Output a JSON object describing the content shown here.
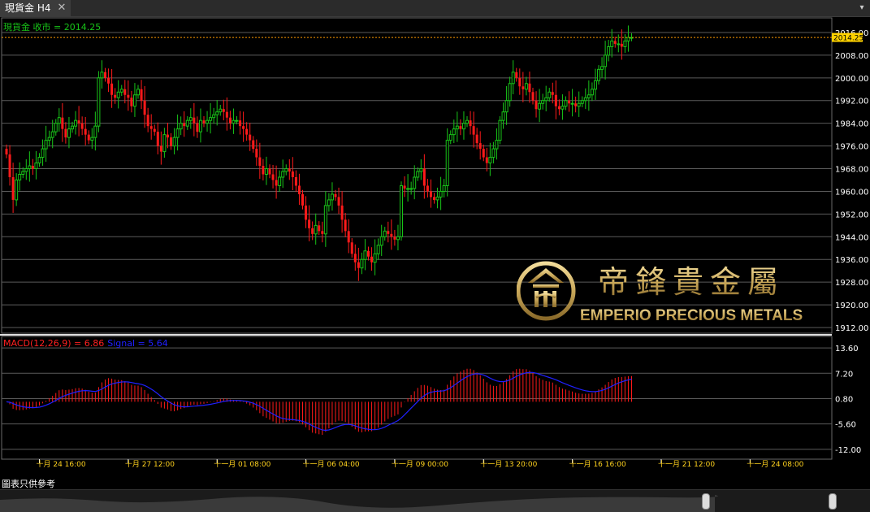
{
  "window": {
    "tab_title": "現貨金 H4",
    "close_glyph": "✕",
    "menu_glyph": "▾"
  },
  "main_legend": "現貨金 收市 = 2014.25",
  "price_label": "2014.25",
  "macd_legend": {
    "macd": "MACD(12,26,9) = 6.86",
    "signal": "Signal = 5.64"
  },
  "disclaimer": "圖表只供參考",
  "logo": {
    "chinese": "帝鋒貴金屬",
    "english": "EMPERIO PRECIOUS METALS"
  },
  "colors": {
    "up": "#18c418",
    "down": "#ff1a1a",
    "signal": "#2020ff",
    "macd_text": "#ff2020",
    "text": "#ffffff",
    "date_text": "#ffd21e",
    "grid": "#5a5a5a",
    "price_line": "#ff9900",
    "gold": "#c9a85a"
  },
  "chart_data": [
    {
      "type": "candlestick",
      "title": "現貨金 H4",
      "y_ticks": [
        2016,
        2008,
        2000,
        1992,
        1984,
        1976,
        1968,
        1960,
        1952,
        1944,
        1936,
        1928,
        1920,
        1912
      ],
      "ylim": [
        1910,
        2020
      ],
      "last_close": 2014.25,
      "x_ticks": [
        {
          "bar": 10,
          "label": "十月 24 16:00"
        },
        {
          "bar": 37,
          "label": "十月 27 12:00"
        },
        {
          "bar": 64,
          "label": "十一月 01 08:00"
        },
        {
          "bar": 91,
          "label": "十一月 06 04:00"
        },
        {
          "bar": 118,
          "label": "十一月 09 00:00"
        },
        {
          "bar": 145,
          "label": "十一月 13 20:00"
        },
        {
          "bar": 172,
          "label": "十一月 16 16:00"
        },
        {
          "bar": 199,
          "label": "十一月 21 12:00"
        },
        {
          "bar": 226,
          "label": "十一月 24 08:00"
        }
      ],
      "closes": [
        1973,
        1965,
        1957,
        1964,
        1966,
        1967,
        1968,
        1969,
        1968,
        1970,
        1972,
        1975,
        1978,
        1979,
        1981,
        1984,
        1986,
        1982,
        1979,
        1982,
        1983,
        1985,
        1984,
        1982,
        1980,
        1978,
        1979,
        1983,
        2000,
        2002,
        2000,
        1998,
        1994,
        1993,
        1995,
        1996,
        1994,
        1993,
        1990,
        1994,
        1996,
        1992,
        1987,
        1983,
        1982,
        1981,
        1976,
        1974,
        1980,
        1979,
        1976,
        1979,
        1982,
        1984,
        1983,
        1985,
        1986,
        1984,
        1981,
        1985,
        1984,
        1985,
        1986,
        1987,
        1988,
        1989,
        1988,
        1986,
        1984,
        1985,
        1985,
        1983,
        1982,
        1980,
        1978,
        1975,
        1972,
        1969,
        1966,
        1968,
        1966,
        1964,
        1962,
        1965,
        1967,
        1968,
        1967,
        1965,
        1962,
        1959,
        1955,
        1950,
        1947,
        1945,
        1948,
        1946,
        1945,
        1955,
        1957,
        1959,
        1958,
        1955,
        1950,
        1946,
        1942,
        1938,
        1935,
        1933,
        1936,
        1939,
        1937,
        1935,
        1938,
        1941,
        1944,
        1946,
        1945,
        1944,
        1943,
        1944,
        1962,
        1961,
        1961,
        1961,
        1965,
        1967,
        1968,
        1962,
        1960,
        1958,
        1957,
        1958,
        1960,
        1962,
        1978,
        1980,
        1982,
        1983,
        1982,
        1984,
        1985,
        1983,
        1980,
        1977,
        1975,
        1972,
        1970,
        1972,
        1975,
        1978,
        1985,
        1988,
        1992,
        1998,
        2002,
        2000,
        1997,
        1996,
        1998,
        1995,
        1992,
        1989,
        1991,
        1992,
        1993,
        1995,
        1994,
        1990,
        1989,
        1990,
        1992,
        1991,
        1991,
        1990,
        1991,
        1992,
        1993,
        1994,
        1996,
        1999,
        2003,
        2004,
        2008,
        2011,
        2013,
        2012,
        2012,
        2011,
        2013,
        2014.25,
        2014.25
      ],
      "first_open": 1975
    },
    {
      "type": "bar+line",
      "title": "MACD(12,26,9)",
      "macd_value": 6.86,
      "signal_value": 5.64,
      "y_ticks": [
        13.6,
        7.2,
        0.8,
        -5.6,
        -12.0
      ],
      "ylim": [
        -14.5,
        16.5
      ],
      "series": [
        {
          "name": "MACD(12,26,9)"
        },
        {
          "name": "Signal"
        }
      ]
    }
  ]
}
